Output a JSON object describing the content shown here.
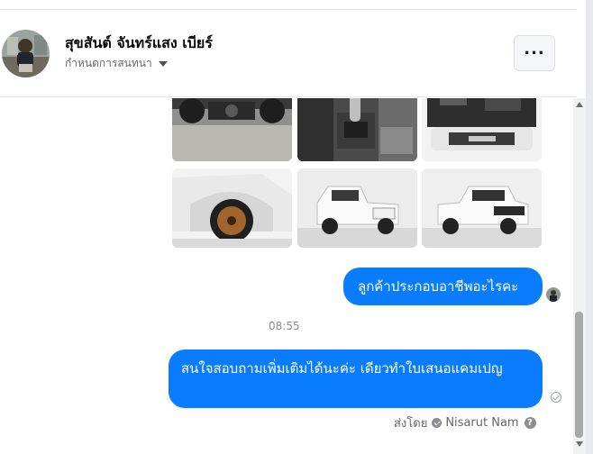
{
  "header": {
    "contact_name": "สุขสันต์ จันทร์แสง เบียร์",
    "settings_label": "กำหนดการสนทนา",
    "more_icon": "more-horizontal-icon",
    "more_glyph": "..."
  },
  "messages": [
    {
      "sender": "self",
      "text": "ลูกค้าประกอบอาชีพอะไรคะ"
    },
    {
      "sender": "self",
      "text": "สนใจสอบถามเพิ่มเติมได้นะค่ะ เดียวทำใบเสนอแคมเปญ"
    }
  ],
  "timestamp": "08:55",
  "sent_by": {
    "label": "ส่งโดย",
    "name": "Nisarut Nam",
    "help": "?"
  },
  "colors": {
    "bubble": "#0a7cff",
    "secondary_text": "#65676b"
  },
  "attachments": [
    {
      "kind": "photo",
      "subject": "truck-undercarriage"
    },
    {
      "kind": "photo",
      "subject": "gear-shifter-interior"
    },
    {
      "kind": "photo",
      "subject": "engine-bay-front"
    },
    {
      "kind": "photo",
      "subject": "wheel-close-up"
    },
    {
      "kind": "photo",
      "subject": "truck-rear-three-quarter"
    },
    {
      "kind": "photo",
      "subject": "truck-front-three-quarter"
    }
  ]
}
